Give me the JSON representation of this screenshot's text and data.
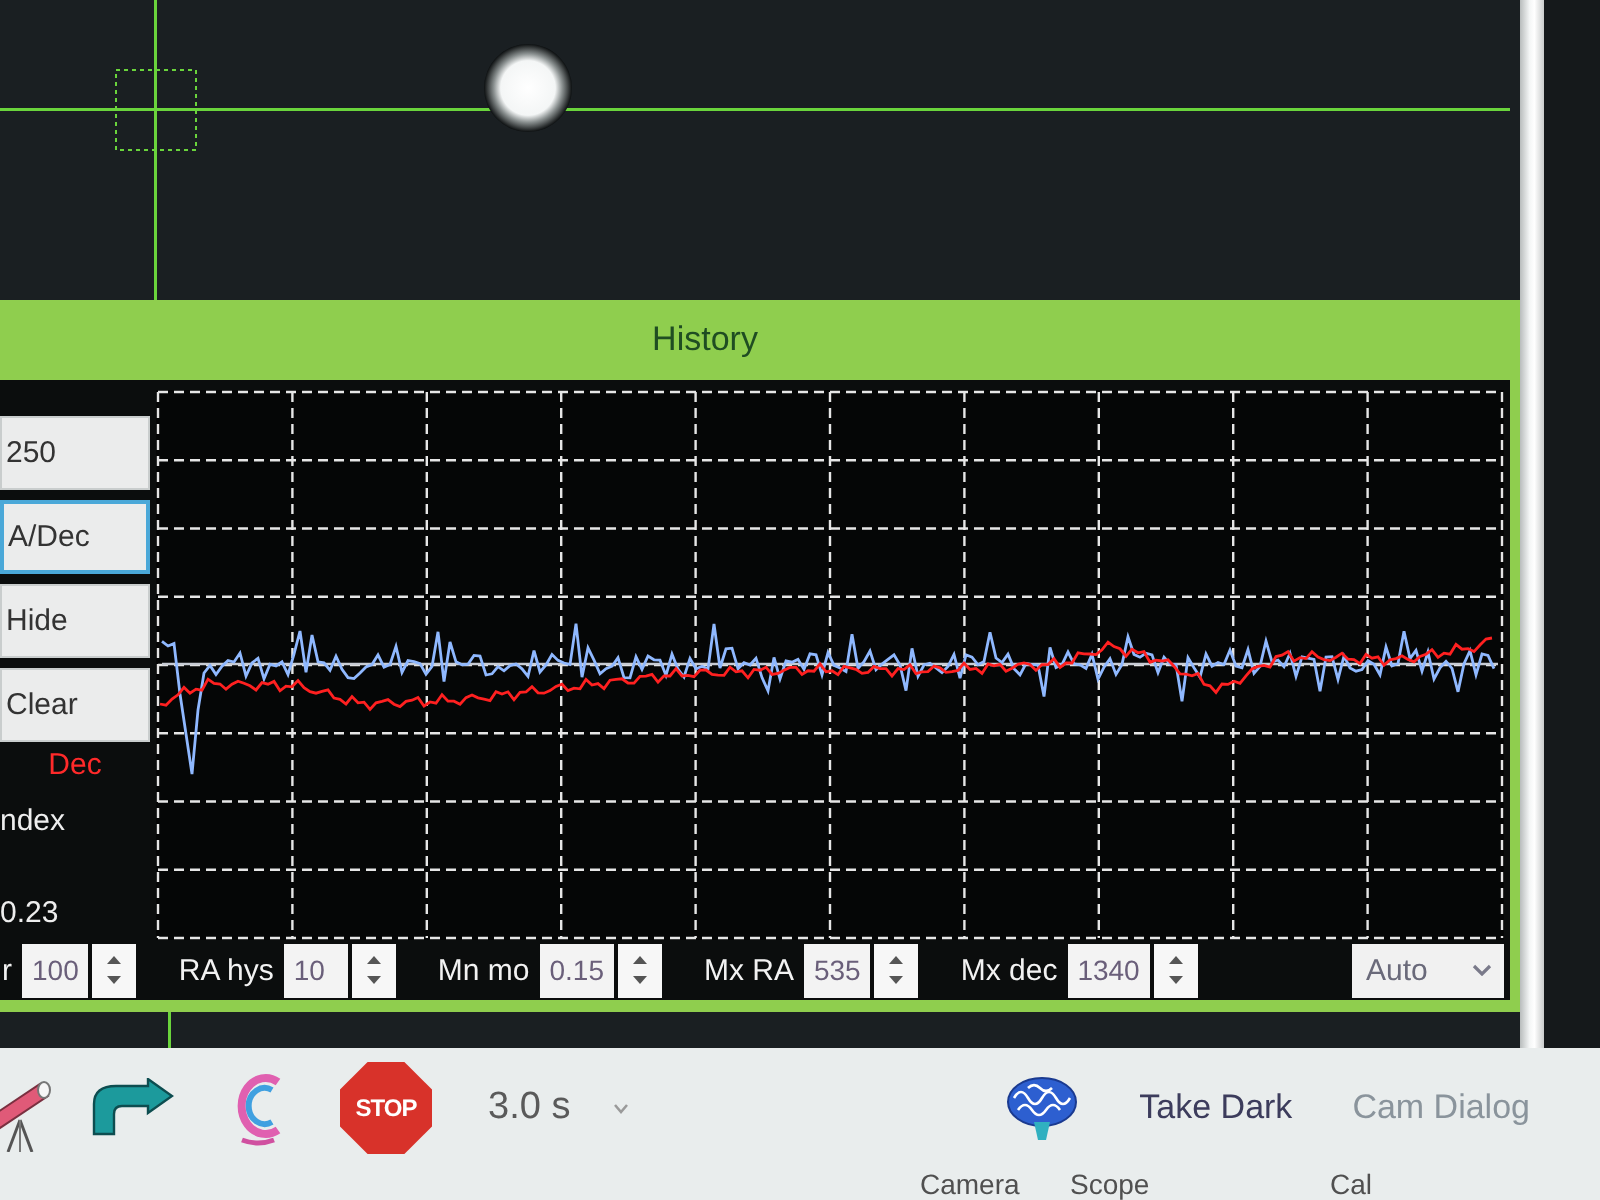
{
  "history": {
    "title": "History",
    "side_buttons": [
      {
        "label": "250",
        "focused": false
      },
      {
        "label": "A/Dec",
        "focused": true
      },
      {
        "label": "Hide",
        "focused": false
      },
      {
        "label": "Clear",
        "focused": false
      }
    ],
    "dec_legend": "Dec",
    "index_label": "ndex",
    "index_value": "0.23",
    "controls": [
      {
        "kind": "spin",
        "label": "r",
        "value": "100"
      },
      {
        "kind": "spin",
        "label": "RA hys",
        "value": "10"
      },
      {
        "kind": "spin",
        "label": "Mn mo",
        "value": "0.15"
      },
      {
        "kind": "spin",
        "label": "Mx RA",
        "value": "535"
      },
      {
        "kind": "spin",
        "label": "Mx dec",
        "value": "1340"
      },
      {
        "kind": "dropdown",
        "value": "Auto"
      }
    ]
  },
  "toolbar": {
    "stop_label": "STOP",
    "exposure": "3.0 s",
    "buttons": [
      {
        "label": "Take Dark",
        "disabled": false
      },
      {
        "label": "Cam Dialog",
        "disabled": true
      }
    ]
  },
  "status_bar": [
    "Camera",
    "Scope",
    "Cal"
  ]
}
